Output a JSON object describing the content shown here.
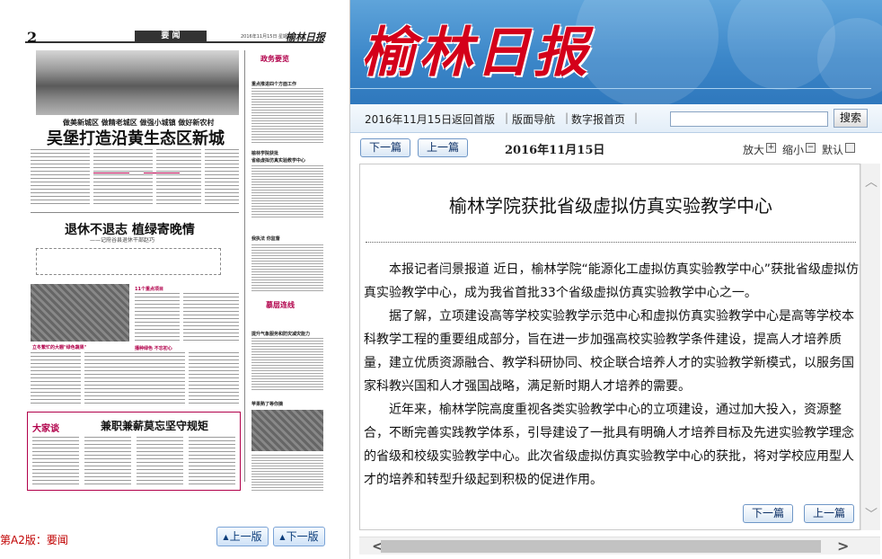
{
  "paper": {
    "page_num": "2",
    "section": "要  闻",
    "header_date": "2016年11月15日  星期二",
    "brand": "榆林日报",
    "kicker": "做美新城区  做精老城区  做强小城镇  做好新农村",
    "headline": "吴堡打造沿黄生态区新城",
    "headline2": "退休不退志  植绿寄晚情",
    "subtitle2": "——记府谷县退休干部赵巧",
    "column_gov": "政务要览",
    "column_gov_sub": "重点推进四个方面工作",
    "column_news1": "榆林学院获批",
    "column_news1_sub": "省级虚拟仿真实验教学中心",
    "column_news2": "我执法 你监督",
    "column_link": "慕层连线",
    "column_weather": "提升气象服务和防灾减灾能力",
    "column_fruit": "苹果熟了等你摘",
    "column_rural": "立冬繁忙的大棚\"绿色蔬果\"",
    "column_talk": "大家谈",
    "column_talk_headline": "兼职兼薪莫忘坚守规矩",
    "col_tag1": "11个重点项目",
    "col_tag2": "播种绿色 不忘初心"
  },
  "left_footer": {
    "page_label": "第A2版：要闻",
    "prev_page": "上一版",
    "next_page": "下一版",
    "arrow": "▲"
  },
  "banner": {
    "logo": "榆林日报"
  },
  "nav": {
    "date": "2016年11月15日",
    "links": [
      "返回首版",
      "版面导航",
      "数字报首页"
    ],
    "separator": "|",
    "search_value": "",
    "search_button": "搜索"
  },
  "toolbar": {
    "next_article": "下一篇",
    "prev_article": "上一篇",
    "issue_date": "2016年11月15日",
    "zoom_in": "放大",
    "zoom_out": "缩小",
    "zoom_default": "默认",
    "plus": "+",
    "minus": "−"
  },
  "article": {
    "title": "榆林学院获批省级虚拟仿真实验教学中心",
    "paragraphs": [
      "本报记者闫景报道  近日，榆林学院“能源化工虚拟仿真实验教学中心”获批省级虚拟仿真实验教学中心，成为我省首批33个省级虚拟仿真实验教学中心之一。",
      "据了解，立项建设高等学校实验教学示范中心和虚拟仿真实验教学中心是高等学校本科教学工程的重要组成部分，旨在进一步加强高校实验教学条件建设，提高人才培养质量，建立优质资源融合、教学科研协同、校企联合培养人才的实验教学新模式，以服务国家科教兴国和人才强国战略，满足新时期人才培养的需要。",
      "近年来，榆林学院高度重视各类实验教学中心的立项建设，通过加大投入，资源整合，不断完善实践教学体系，引导建设了一批具有明确人才培养目标及先进实验教学理念的省级和校级实验教学中心。此次省级虚拟仿真实验教学中心的获批，将对学校应用型人才的培养和转型升级起到积极的促进作用。"
    ],
    "next_article": "下一篇",
    "prev_article": "上一篇"
  },
  "scrollbar": {
    "up": "︿",
    "down": "﹀",
    "left": "<",
    "right": ">"
  }
}
